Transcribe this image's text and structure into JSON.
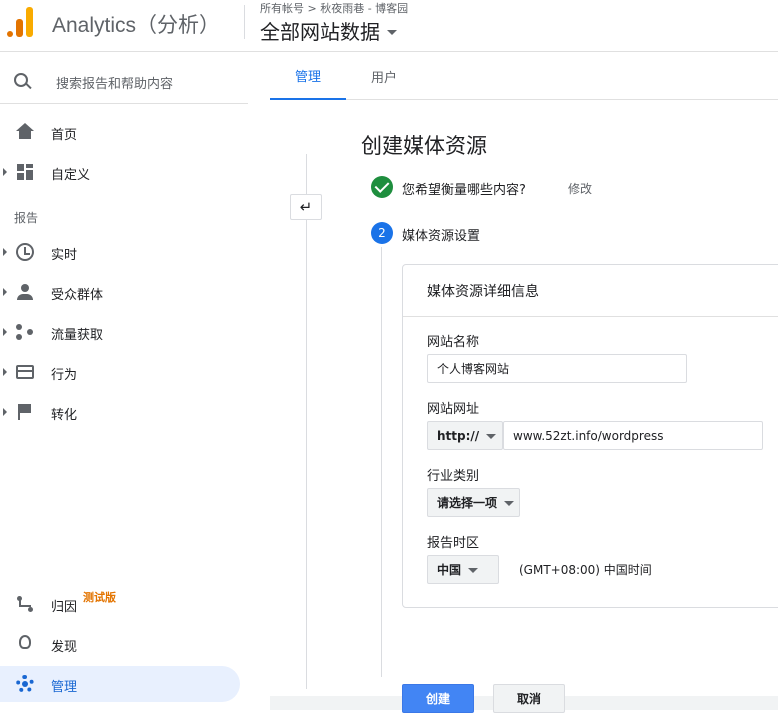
{
  "header": {
    "app_title": "Analytics（分析）",
    "breadcrumb": "所有帐号 > 秋夜雨巷 - 博客园",
    "property": "全部网站数据"
  },
  "sidebar": {
    "search_placeholder": "搜索报告和帮助内容",
    "items": [
      {
        "label": "首页",
        "icon": "home-icon"
      },
      {
        "label": "自定义",
        "icon": "dashboard-icon"
      },
      {
        "label": "实时",
        "icon": "clock-icon"
      },
      {
        "label": "受众群体",
        "icon": "person-icon"
      },
      {
        "label": "流量获取",
        "icon": "acquisition-icon"
      },
      {
        "label": "行为",
        "icon": "behavior-icon"
      },
      {
        "label": "转化",
        "icon": "flag-icon"
      }
    ],
    "section_reports": "报告",
    "bottom": [
      {
        "label": "归因",
        "badge": "测试版",
        "icon": "attribution-icon"
      },
      {
        "label": "发现",
        "icon": "lightbulb-icon"
      },
      {
        "label": "管理",
        "icon": "gear-icon"
      }
    ]
  },
  "tabs": [
    "管理",
    "用户"
  ],
  "form": {
    "page_title": "创建媒体资源",
    "step1_label": "您希望衡量哪些内容?",
    "step1_edit": "修改",
    "step2_number": "2",
    "step2_label": "媒体资源设置",
    "card_title": "媒体资源详细信息",
    "site_name_label": "网站名称",
    "site_name_value": "个人博客网站",
    "site_url_label": "网站网址",
    "protocol": "http://",
    "site_url_value": "www.52zt.info/wordpress",
    "industry_label": "行业类别",
    "industry_value": "请选择一项",
    "timezone_label": "报告时区",
    "country_value": "中国",
    "timezone_value": "(GMT+08:00) 中国时间",
    "create_button": "创建",
    "cancel_button": "取消"
  },
  "colors": {
    "accent": "#1a73e8",
    "success": "#1e8e3e",
    "brand_orange": "#e37400",
    "brand_yellow": "#f9ab00"
  }
}
